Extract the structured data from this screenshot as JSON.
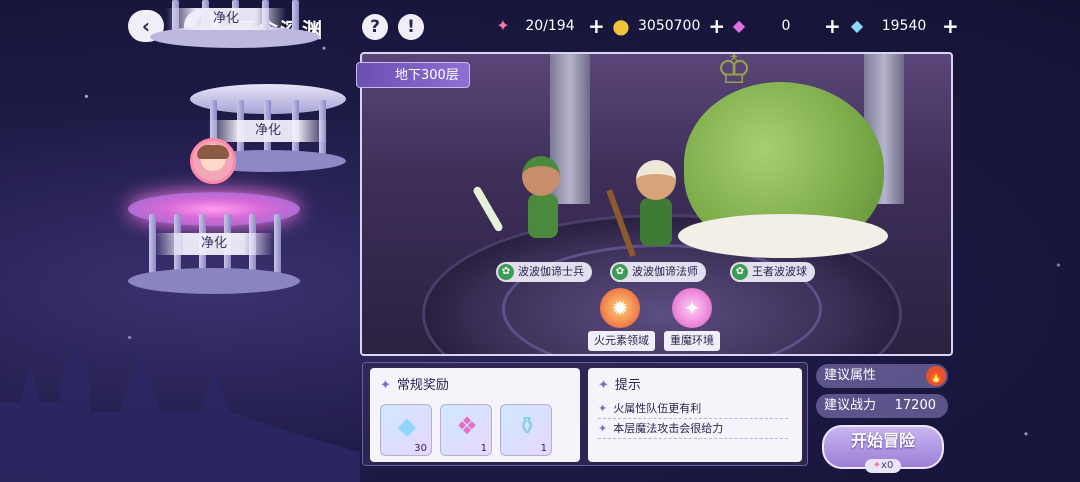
{
  "header": {
    "title": "恶念深渊",
    "back_icon": "back-arrow",
    "help_icon": "?",
    "info_icon": "!"
  },
  "resources": [
    {
      "name": "candy",
      "icon": "🍬",
      "value": "20/194"
    },
    {
      "name": "gold",
      "icon": "●",
      "value": "3050700"
    },
    {
      "name": "pink-crystal",
      "icon": "◆",
      "value": "0"
    },
    {
      "name": "diamond",
      "icon": "◆",
      "value": "19540"
    }
  ],
  "tower": {
    "floors": [
      {
        "label": "净化"
      },
      {
        "label": "净化"
      },
      {
        "label": "净化"
      }
    ]
  },
  "stage": {
    "floor_name": "地下300层",
    "enemies": [
      {
        "name": "波波伽谛士兵"
      },
      {
        "name": "波波伽谛法师"
      },
      {
        "name": "王者波波球"
      }
    ],
    "environments": [
      {
        "label": "火元素领域",
        "color": "#e8502e"
      },
      {
        "label": "重魔环境",
        "color": "#e056c6"
      }
    ]
  },
  "rewards": {
    "title": "常规奖励",
    "items": [
      {
        "name": "diamond",
        "count": "30"
      },
      {
        "name": "crystal-emblem",
        "count": "1"
      },
      {
        "name": "potion",
        "count": "1"
      }
    ]
  },
  "tips": {
    "title": "提示",
    "items": [
      "火属性队伍更有利",
      "本层魔法攻击会很给力"
    ]
  },
  "recommend": {
    "attr_label": "建议属性",
    "attr_element": "fire",
    "power_label": "建议战力",
    "power_value": "17200"
  },
  "start": {
    "label": "开始冒险",
    "cost": "x0"
  },
  "colors": {
    "accent": "#8f6fd4",
    "fire": "#e8502e",
    "leaf": "#3d9c53"
  }
}
